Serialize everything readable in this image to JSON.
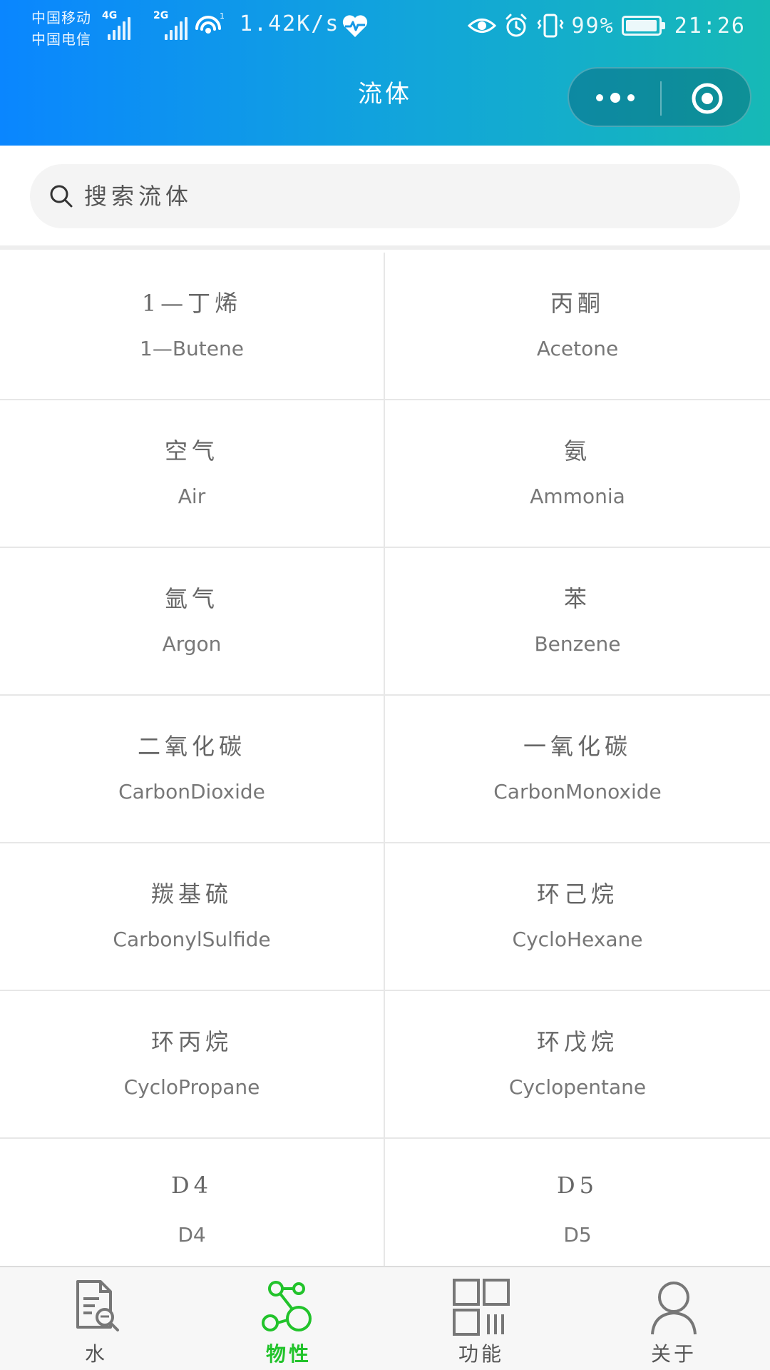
{
  "status_bar": {
    "carrier_1": "中国移动",
    "carrier_2": "中国电信",
    "net_1": "4G",
    "net_2": "2G",
    "wifi_badge": "1",
    "speed": "1.42K/s",
    "battery": "99%",
    "battery_level": 0.99,
    "time": "21:26"
  },
  "nav": {
    "title": "流体"
  },
  "search": {
    "placeholder": "搜索流体",
    "value": ""
  },
  "fluids": [
    {
      "cn": "1—丁烯",
      "en": "1—Butene"
    },
    {
      "cn": "丙酮",
      "en": "Acetone"
    },
    {
      "cn": "空气",
      "en": "Air"
    },
    {
      "cn": "氨",
      "en": "Ammonia"
    },
    {
      "cn": "氩气",
      "en": "Argon"
    },
    {
      "cn": "苯",
      "en": "Benzene"
    },
    {
      "cn": "二氧化碳",
      "en": "CarbonDioxide"
    },
    {
      "cn": "一氧化碳",
      "en": "CarbonMonoxide"
    },
    {
      "cn": "羰基硫",
      "en": "CarbonylSulfide"
    },
    {
      "cn": "环己烷",
      "en": "CycloHexane"
    },
    {
      "cn": "环丙烷",
      "en": "CycloPropane"
    },
    {
      "cn": "环戊烷",
      "en": "Cyclopentane"
    },
    {
      "cn": "D4",
      "en": "D4"
    },
    {
      "cn": "D5",
      "en": "D5"
    }
  ],
  "tabbar": {
    "tabs": [
      {
        "label": "水",
        "icon": "document-search-icon",
        "active": false
      },
      {
        "label": "物性",
        "icon": "molecule-icon",
        "active": true
      },
      {
        "label": "功能",
        "icon": "grid-icon",
        "active": false
      },
      {
        "label": "关于",
        "icon": "user-icon",
        "active": false
      }
    ]
  },
  "colors": {
    "header_start": "#0a86ff",
    "header_end": "#16b9b6",
    "active_tab": "#22c32b",
    "inactive_tab": "#555555"
  }
}
